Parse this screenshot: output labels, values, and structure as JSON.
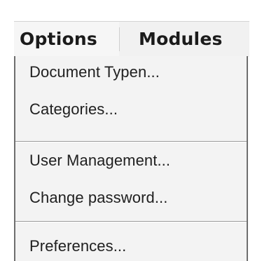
{
  "menubar": {
    "options_label": "Options",
    "modules_label": "Modules"
  },
  "dropdown": {
    "items": [
      {
        "label": "Document Typen..."
      },
      {
        "label": "Categories..."
      },
      {
        "label": "User Management..."
      },
      {
        "label": "Change password..."
      },
      {
        "label": "Preferences..."
      }
    ]
  },
  "colors": {
    "menu_background": "#f3f3f3",
    "border": "#6e6e6e",
    "separator": "#9a9a9a",
    "text": "#202020"
  }
}
